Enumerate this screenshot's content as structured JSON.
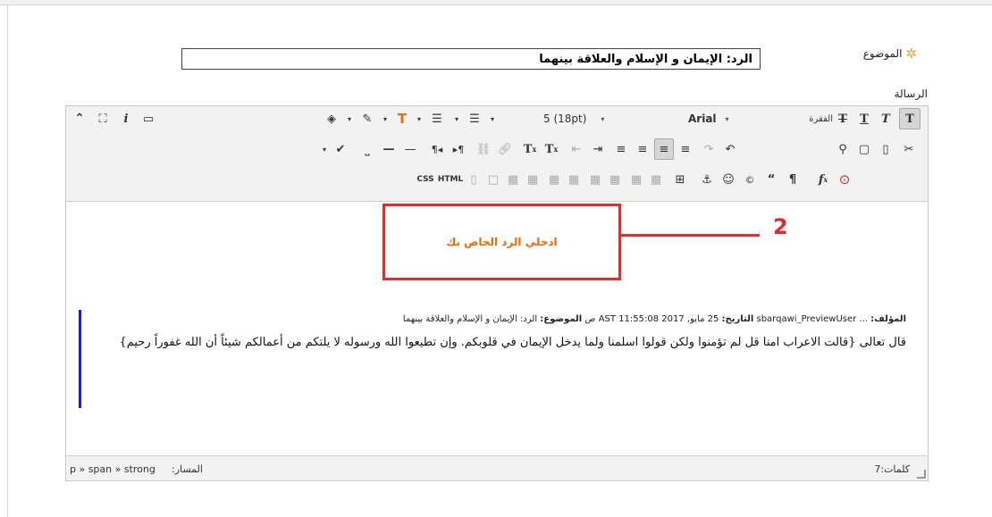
{
  "form": {
    "subject_label": "الموضوع",
    "subject_value": "الرد: الإيمان و الإسلام والعلاقة بينهما",
    "message_label": "الرسالة"
  },
  "toolbar": {
    "row1": {
      "paragraph_select": "الفقرة",
      "font_select": "Arial",
      "size_select": "5 (18pt)"
    }
  },
  "content": {
    "meta_author_label": "المؤلف:",
    "meta_author_value": "... sbarqawi_PreviewUser",
    "meta_date_label": "التاريخ:",
    "meta_date_value": "25 مايو, 2017 11:55:08 AST ص",
    "meta_subject_label": "الموضوع:",
    "meta_subject_value": "الرد: الإيمان و الإسلام والعلاقة بينهما",
    "body": "قال تعالى {قالت الاعراب امنا قل لم تؤمنوا ولكن قولوا اسلمنا ولما يدخل الإيمان في قلوبكم. وإن تطيعوا الله ورسوله لا يلتكم من أعمالكم شيئاً أن الله غفوراً رحيم}"
  },
  "statusbar": {
    "path_label": "المسار:",
    "path_value": "p » span » strong",
    "word_count": "كلمات:7"
  },
  "annotation": {
    "callout_text": "ادخلي الرد الخاص بك",
    "callout_number": "2"
  },
  "colors": {
    "accent_red": "#e52b2b",
    "accent_orange": "#f06a00",
    "quote_border": "#1a1ae6"
  }
}
